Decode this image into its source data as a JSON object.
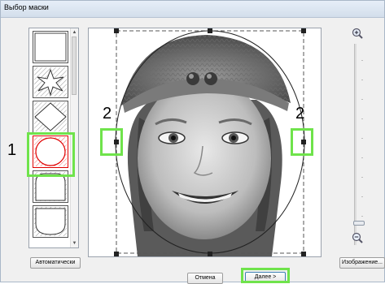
{
  "window": {
    "title": "Выбор маски"
  },
  "callouts": {
    "one": "1",
    "two_left": "2",
    "two_right": "2"
  },
  "buttons": {
    "auto": "Автоматически",
    "cancel": "Отмена",
    "next": "Далее >",
    "image": "Изображение..."
  },
  "shapes": [
    "square",
    "star",
    "diamond",
    "circle",
    "arch",
    "bottom-rounded"
  ],
  "selected_shape": "circle",
  "colors": {
    "highlight": "#6fe34b",
    "selected_shape": "#e00000"
  },
  "icons": {
    "zoom_in": "zoom-in-icon",
    "zoom_out": "zoom-out-icon"
  }
}
